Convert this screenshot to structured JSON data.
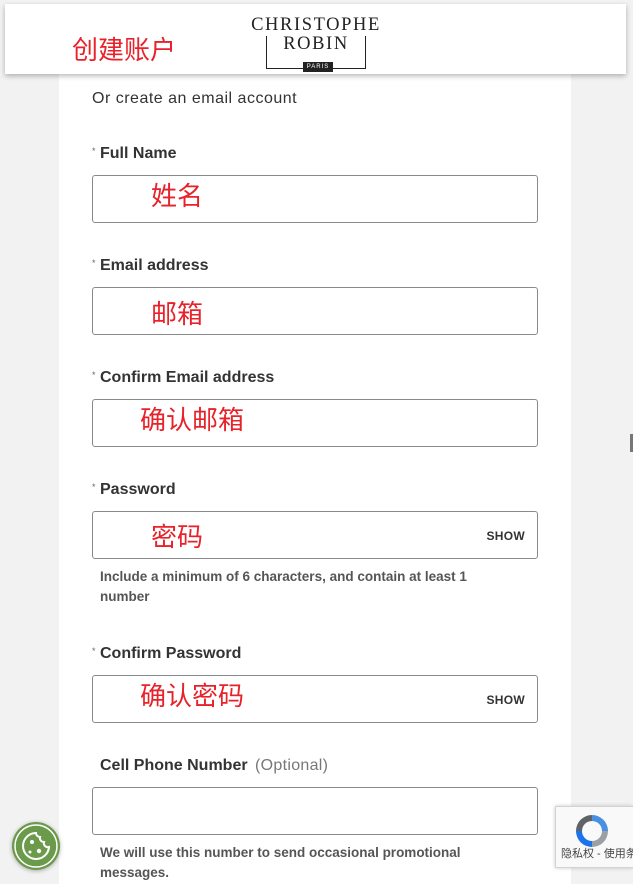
{
  "header": {
    "annotation": "创建账户",
    "logo": {
      "line1": "CHRISTOPHE",
      "line2": "ROBIN",
      "tag": "PARIS"
    }
  },
  "form": {
    "intro": "Or create an email account",
    "required_mark": "*",
    "full_name": {
      "label": "Full Name",
      "annotation": "姓名"
    },
    "email": {
      "label": "Email address",
      "annotation": "邮箱"
    },
    "confirm_email": {
      "label": "Confirm Email address",
      "annotation": "确认邮箱"
    },
    "password": {
      "label": "Password",
      "annotation": "密码",
      "toggle": "SHOW",
      "hint": "Include a minimum of 6 characters, and contain at least 1 number"
    },
    "confirm_password": {
      "label": "Confirm Password",
      "annotation": "确认密码",
      "toggle": "SHOW"
    },
    "phone": {
      "label": "Cell Phone Number",
      "optional": "(Optional)",
      "value": "",
      "hint": "We will use this number to send occasional promotional messages."
    }
  },
  "recaptcha": {
    "text": "隐私权 - 使用条款"
  },
  "icons": {
    "cookie": "cookie-icon",
    "recaptcha": "recaptcha-icon"
  },
  "colors": {
    "annotation": "#e8222a",
    "cookie_button": "#6b9a4a",
    "recaptcha_blue": "#4a90e2"
  }
}
